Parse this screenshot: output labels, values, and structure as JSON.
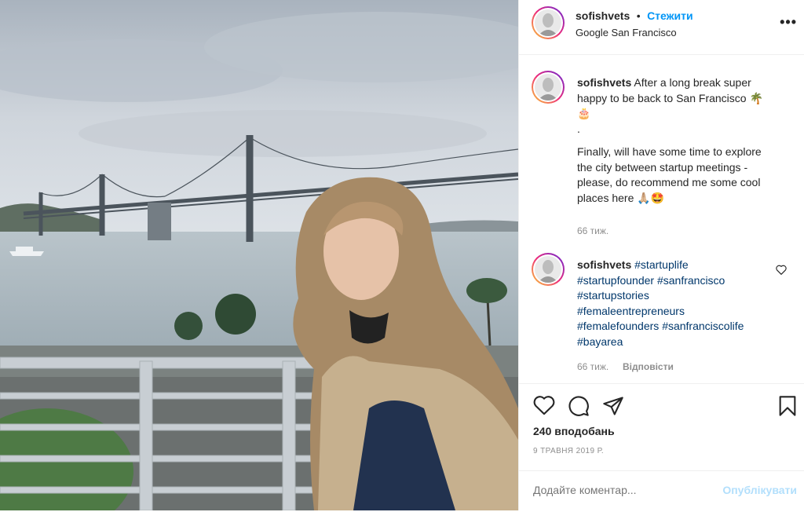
{
  "post": {
    "username": "sofishvets",
    "follow_label": "Стежити",
    "location": "Google San Francisco",
    "more_icon": "more-horizontal-icon"
  },
  "caption": {
    "username": "sofishvets",
    "line1": "After a long break super",
    "line2": "happy to be back to San Francisco 🌴",
    "line3": "🎂",
    "line4": ".",
    "line5": "Finally, will have some time to explore",
    "line6": "the city between startup meetings -",
    "line7": "please, do recommend me some cool",
    "line8": "places here 🙏🏼🤩",
    "time": "66 тиж."
  },
  "comment": {
    "username": "sofishvets",
    "tags": [
      "#startuplife",
      "#startupfounder",
      "#sanfrancisco",
      "#startupstories",
      "#femaleentrepreneurs",
      "#femalefounders",
      "#sanfranciscolife",
      "#bayarea"
    ],
    "time": "66 тиж.",
    "reply_label": "Відповісти"
  },
  "actions": {
    "likes": "240 вподобань",
    "date": "9 ТРАВНЯ 2019 Р.",
    "comment_placeholder": "Додайте коментар...",
    "publish_label": "Опублікувати"
  },
  "colors": {
    "accent": "#0095f6",
    "muted": "#8e8e8e",
    "hashtag": "#00376b"
  }
}
